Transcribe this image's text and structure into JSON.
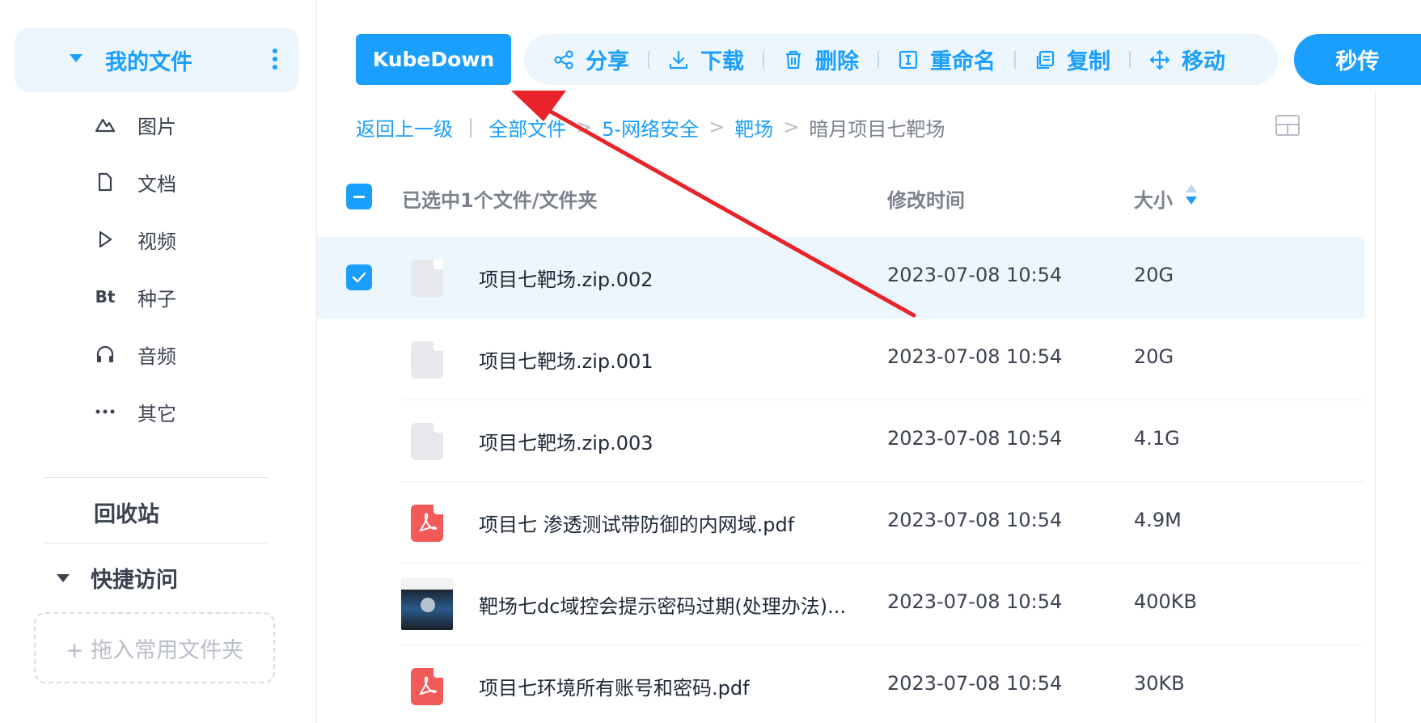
{
  "sidebar": {
    "my_files": "我的文件",
    "items": [
      {
        "label": "图片",
        "icon": "mountain-icon"
      },
      {
        "label": "文档",
        "icon": "document-icon"
      },
      {
        "label": "视频",
        "icon": "play-icon"
      },
      {
        "label": "种子",
        "icon": "bt-icon",
        "glyph": "Bt"
      },
      {
        "label": "音频",
        "icon": "headphones-icon"
      },
      {
        "label": "其它",
        "icon": "more-dots-icon"
      }
    ],
    "recycle": "回收站",
    "quick_access": "快捷访问",
    "drop_hint": "+ 拖入常用文件夹"
  },
  "toolbar": {
    "kubedown": "KubeDown",
    "share": "分享",
    "download": "下载",
    "delete": "删除",
    "rename": "重命名",
    "copy": "复制",
    "move": "移动",
    "instant": "秒传"
  },
  "breadcrumb": {
    "back": "返回上一级",
    "all": "全部文件",
    "sep": ">",
    "level1": "5-网络安全",
    "level2": "靶场",
    "current": "暗月项目七靶场"
  },
  "table": {
    "selected_label": "已选中1个文件/文件夹",
    "col_time": "修改时间",
    "col_size": "大小",
    "rows": [
      {
        "name": "项目七靶场.zip.002",
        "time": "2023-07-08 10:54",
        "size": "20G",
        "type": "cloud",
        "selected": true
      },
      {
        "name": "项目七靶场.zip.001",
        "time": "2023-07-08 10:54",
        "size": "20G",
        "type": "cloud",
        "selected": false
      },
      {
        "name": "项目七靶场.zip.003",
        "time": "2023-07-08 10:54",
        "size": "4.1G",
        "type": "cloud",
        "selected": false
      },
      {
        "name": "项目七 渗透测试带防御的内网域.pdf",
        "time": "2023-07-08 10:54",
        "size": "4.9M",
        "type": "pdf",
        "selected": false
      },
      {
        "name": "靶场七dc域控会提示密码过期(处理办法)...",
        "time": "2023-07-08 10:54",
        "size": "400KB",
        "type": "image",
        "selected": false
      },
      {
        "name": "项目七环境所有账号和密码.pdf",
        "time": "2023-07-08 10:54",
        "size": "30KB",
        "type": "pdf",
        "selected": false
      }
    ]
  },
  "colors": {
    "accent": "#1a9fff",
    "accent_light": "#eef6fd",
    "annotation_arrow": "#e8232a"
  }
}
